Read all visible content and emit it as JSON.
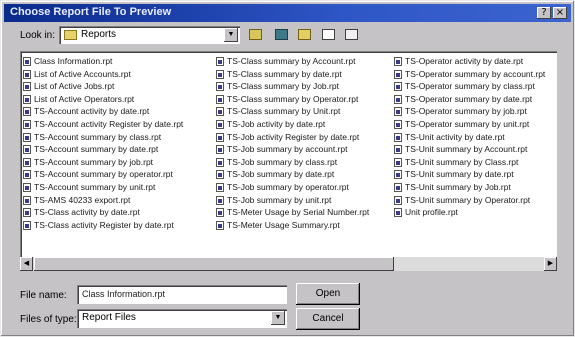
{
  "window": {
    "title": "Choose Report File To Preview",
    "help_glyph": "?",
    "close_glyph": "×"
  },
  "toolbar": {
    "look_in_label": "Look in:",
    "look_in_value": "Reports",
    "dropdown_glyph": "▼"
  },
  "files": {
    "columns": [
      [
        "Class Information.rpt",
        "List of Active Accounts.rpt",
        "List of Active Jobs.rpt",
        "List of Active Operators.rpt",
        "TS-Account activity by date.rpt",
        "TS-Account activity Register by date.rpt",
        "TS-Account summary by class.rpt",
        "TS-Account summary by date.rpt",
        "TS-Account summary by job.rpt",
        "TS-Account summary by operator.rpt",
        "TS-Account summary by unit.rpt",
        "TS-AMS 40233 export.rpt",
        "TS-Class activity by date.rpt",
        "TS-Class activity Register by date.rpt"
      ],
      [
        "TS-Class summary by Account.rpt",
        "TS-Class summary by date.rpt",
        "TS-Class summary by Job.rpt",
        "TS-Class summary by Operator.rpt",
        "TS-Class summary by Unit.rpt",
        "TS-Job activity by date.rpt",
        "TS-Job activity Register by date.rpt",
        "TS-Job summary by account.rpt",
        "TS-Job summary by class.rpt",
        "TS-Job summary by date.rpt",
        "TS-Job summary by operator.rpt",
        "TS-Job summary by unit.rpt",
        "TS-Meter Usage by Serial Number.rpt",
        "TS-Meter Usage Summary.rpt"
      ],
      [
        "TS-Operator activity by date.rpt",
        "TS-Operator summary by account.rpt",
        "TS-Operator summary by class.rpt",
        "TS-Operator summary by date.rpt",
        "TS-Operator summary by job.rpt",
        "TS-Operator summary by unit.rpt",
        "TS-Unit activity by date.rpt",
        "TS-Unit summary by Account.rpt",
        "TS-Unit summary by Class.rpt",
        "TS-Unit summary by date.rpt",
        "TS-Unit summary by Job.rpt",
        "TS-Unit summary by Operator.rpt",
        "Unit profile.rpt"
      ]
    ],
    "scroll_left_glyph": "◀",
    "scroll_right_glyph": "▶"
  },
  "form": {
    "file_name_label": "File name:",
    "file_name_value": "Class Information.rpt",
    "file_type_label": "Files of type:",
    "file_type_value": "Report Files",
    "open_label": "Open",
    "cancel_label": "Cancel"
  },
  "colors": {
    "title_bar": "#0a2a8c",
    "dialog_face": "#c6c3c6"
  }
}
